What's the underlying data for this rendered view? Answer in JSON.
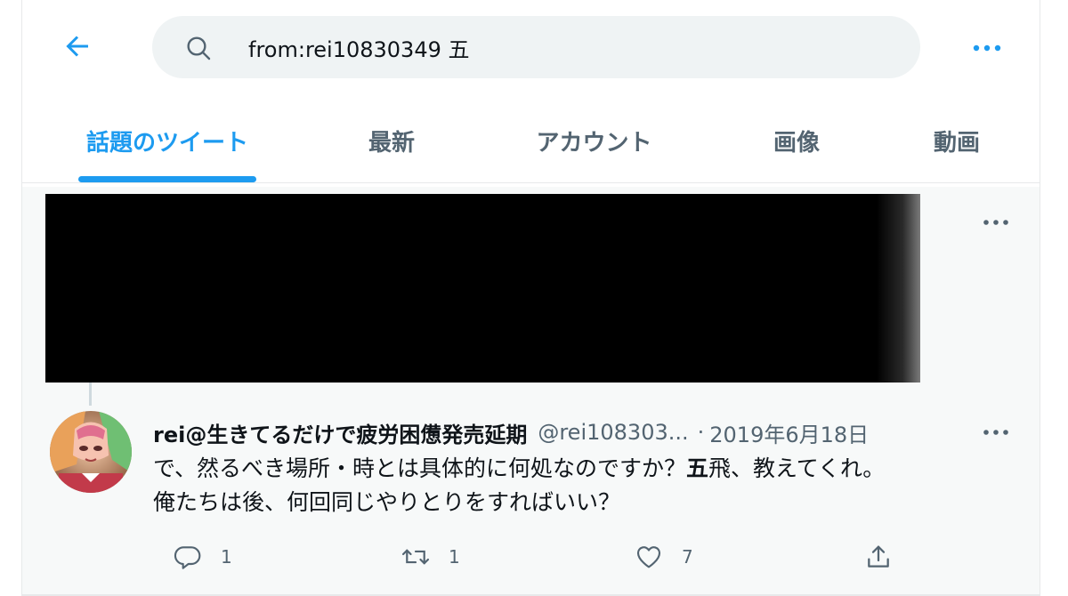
{
  "search": {
    "query": "from:rei10830349 五"
  },
  "tabs": [
    {
      "label": "話題のツイート",
      "active": true
    },
    {
      "label": "最新",
      "active": false
    },
    {
      "label": "アカウント",
      "active": false
    },
    {
      "label": "画像",
      "active": false
    },
    {
      "label": "動画",
      "active": false
    }
  ],
  "tweet": {
    "display_name": "rei@生きてるだけで疲労困憊発売延期",
    "handle": "@rei108303...",
    "separator": "·",
    "date": "2019年6月18日",
    "text_before": "で、然るべき場所・時とは具体的に何処なのですか？",
    "text_highlight": "五",
    "text_after_line1": "飛、教えてくれ。",
    "text_line2": "俺たちは後、何回同じやりとりをすればいい？",
    "reply_count": "1",
    "retweet_count": "1",
    "like_count": "7"
  },
  "colors": {
    "accent": "#1d9bf0",
    "secondary_text": "#536471",
    "primary_text": "#0f1419",
    "search_bg": "#eff3f4",
    "tweet_bg": "#f7f9f9"
  },
  "icons": {
    "back": "arrow-left-icon",
    "search": "search-icon",
    "more": "more-dots-icon",
    "reply": "reply-icon",
    "retweet": "retweet-icon",
    "like": "heart-icon",
    "share": "share-icon"
  }
}
